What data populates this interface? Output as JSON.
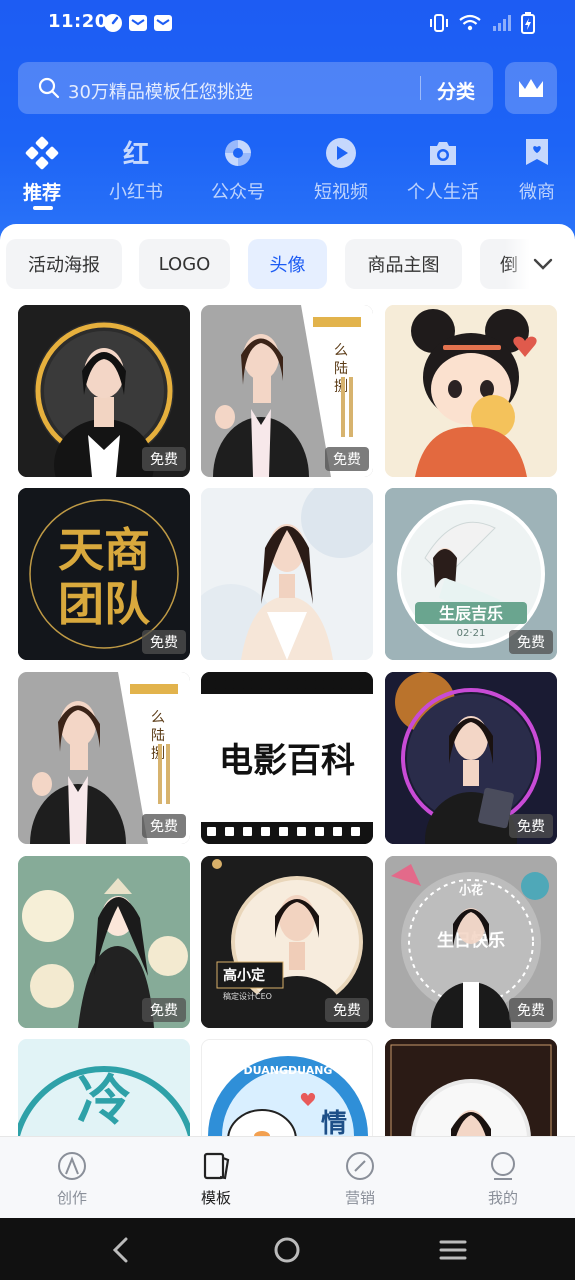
{
  "status": {
    "time": "11:20"
  },
  "search": {
    "placeholder": "30万精品模板任您挑选",
    "category_label": "分类"
  },
  "categories": [
    {
      "label": "推荐",
      "icon": "diamond-grid-icon",
      "active": true
    },
    {
      "label": "小红书",
      "icon": "xiaohongshu-icon",
      "active": false
    },
    {
      "label": "公众号",
      "icon": "wechat-official-icon",
      "active": false
    },
    {
      "label": "短视频",
      "icon": "play-icon",
      "active": false
    },
    {
      "label": "个人生活",
      "icon": "camera-icon",
      "active": false
    },
    {
      "label": "微商",
      "icon": "bookmark-heart-icon",
      "active": false
    }
  ],
  "chips": [
    {
      "label": "活动海报",
      "active": false
    },
    {
      "label": "LOGO",
      "active": false
    },
    {
      "label": "头像",
      "active": true
    },
    {
      "label": "商品主图",
      "active": false
    },
    {
      "label": "倒",
      "active": false
    }
  ],
  "cards": [
    {
      "free": "免费",
      "text": ""
    },
    {
      "free": "免费",
      "text": "么陆捌"
    },
    {
      "free": "",
      "text": ""
    },
    {
      "free": "免费",
      "text": "天商团队"
    },
    {
      "free": "",
      "text": ""
    },
    {
      "free": "免费",
      "text": "生辰吉乐",
      "sub": "02·21"
    },
    {
      "free": "免费",
      "text": "么陆捌"
    },
    {
      "free": "",
      "text": "电影百科"
    },
    {
      "free": "免费",
      "text": ""
    },
    {
      "free": "免费",
      "text": ""
    },
    {
      "free": "免费",
      "text": "高小定",
      "sub": "稿定设计CEO"
    },
    {
      "free": "免费",
      "text": "生日快乐",
      "sub": "小花"
    },
    {
      "free": "",
      "text": "冷"
    },
    {
      "free": "",
      "text": "DUANGDUANG",
      "sub": "情"
    },
    {
      "free": "",
      "text": ""
    }
  ],
  "bottom_nav": [
    {
      "label": "创作",
      "icon": "create-icon",
      "active": false
    },
    {
      "label": "模板",
      "icon": "template-icon",
      "active": true
    },
    {
      "label": "营销",
      "icon": "marketing-icon",
      "active": false
    },
    {
      "label": "我的",
      "icon": "profile-icon",
      "active": false
    }
  ],
  "colors": {
    "brand_blue": "#1d5cf3",
    "chip_active_bg": "#e6efff"
  }
}
